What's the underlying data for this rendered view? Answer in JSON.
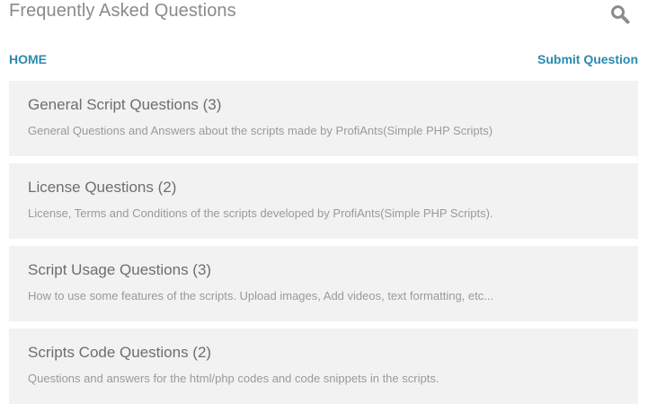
{
  "header": {
    "title": "Frequently Asked Questions",
    "search_icon": "search-icon"
  },
  "nav": {
    "home_label": "HOME",
    "submit_label": "Submit Question"
  },
  "categories": [
    {
      "title": "General Script Questions (3)",
      "description": "General Questions and Answers about the scripts made by ProfiAnts(Simple PHP Scripts)"
    },
    {
      "title": "License Questions (2)",
      "description": "License, Terms and Conditions of the scripts developed by ProfiAnts(Simple PHP Scripts)."
    },
    {
      "title": "Script Usage Questions (3)",
      "description": "How to use some features of the scripts. Upload images, Add videos, text formatting, etc..."
    },
    {
      "title": "Scripts Code Questions (2)",
      "description": "Questions and answers for the html/php codes and code snippets in the scripts."
    }
  ],
  "colors": {
    "link": "#2a8ab0",
    "card_bg": "#f2f2f2",
    "title_text": "#8a8a8a"
  }
}
